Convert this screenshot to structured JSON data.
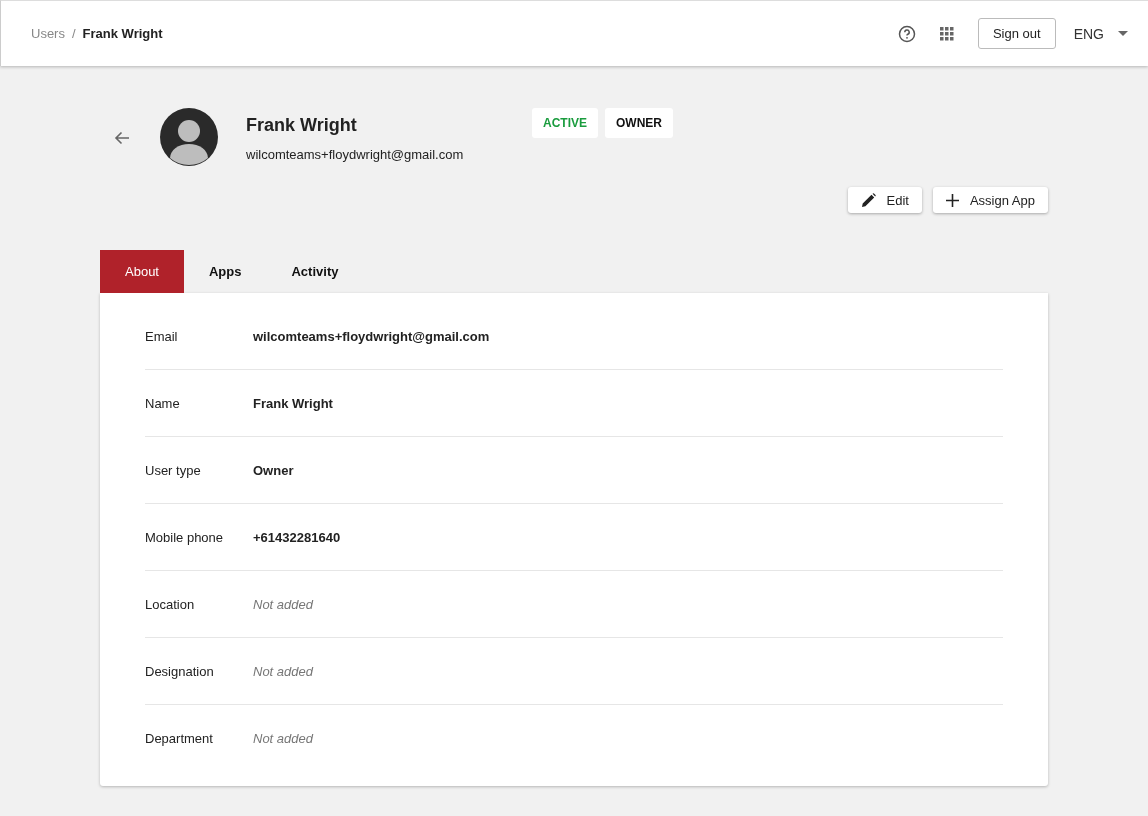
{
  "breadcrumb": [
    {
      "label": "Users",
      "current": false
    },
    {
      "label": "Frank Wright",
      "current": true
    }
  ],
  "breadcrumb_separator": "/",
  "header": {
    "sign_out": "Sign out",
    "language": "ENG"
  },
  "profile": {
    "name": "Frank Wright",
    "email": "wilcomteams+floydwright@gmail.com",
    "badges": [
      {
        "label": "ACTIVE",
        "color": "#1a9c3e"
      },
      {
        "label": "OWNER",
        "color": "#111111"
      }
    ]
  },
  "actions": [
    {
      "label": "Edit",
      "kind": "edit"
    },
    {
      "label": "Assign App",
      "kind": "add"
    }
  ],
  "tabs": [
    {
      "label": "About",
      "selected": true
    },
    {
      "label": "Apps",
      "selected": false
    },
    {
      "label": "Activity",
      "selected": false
    }
  ],
  "fields": [
    {
      "label": "Email",
      "value": "wilcomteams+floydwright@gmail.com",
      "kind": "value"
    },
    {
      "label": "Name",
      "value": "Frank Wright",
      "kind": "value"
    },
    {
      "label": "User type",
      "value": "Owner",
      "kind": "value"
    },
    {
      "label": "Mobile phone",
      "value": "+61432281640",
      "kind": "value"
    },
    {
      "label": "Location",
      "value": "Not added",
      "kind": "missing"
    },
    {
      "label": "Designation",
      "value": "Not added",
      "kind": "missing"
    },
    {
      "label": "Department",
      "value": "Not added",
      "kind": "missing"
    }
  ]
}
